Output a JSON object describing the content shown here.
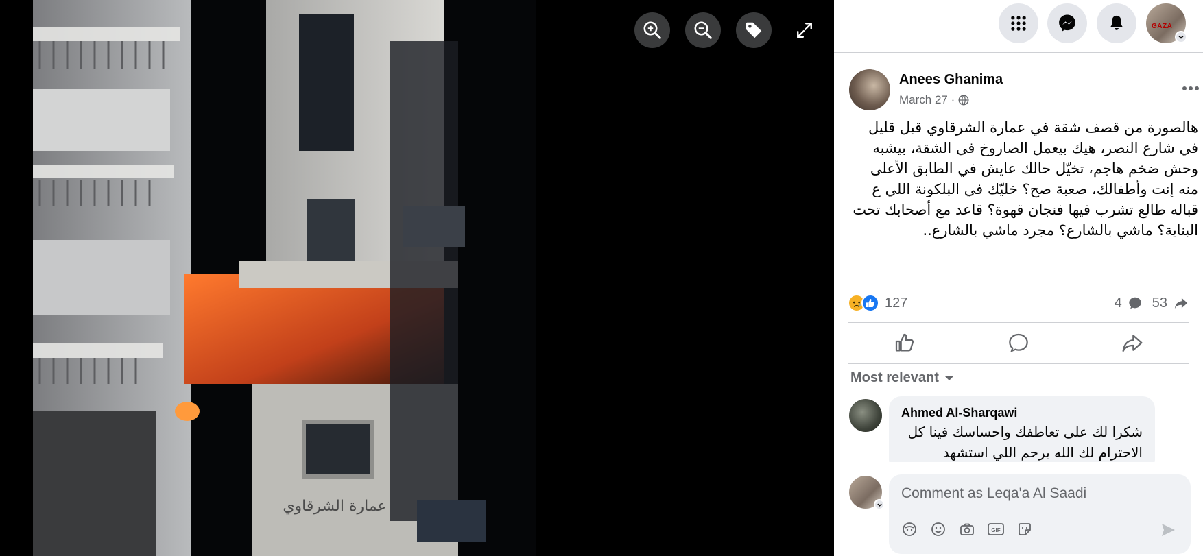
{
  "viewer": {
    "photo_alt": "Night photo of a damaged apartment building with fire on a balcony",
    "building_sign_text": "عمارة الشرقاوي",
    "tools": [
      {
        "name": "zoom-in",
        "icon": "zoom-in-icon"
      },
      {
        "name": "zoom-out",
        "icon": "zoom-out-icon"
      },
      {
        "name": "tag",
        "icon": "tag-icon"
      },
      {
        "name": "fullscreen",
        "icon": "expand-icon"
      }
    ]
  },
  "topbar": {
    "buttons": [
      {
        "name": "menu",
        "icon": "grid-menu-icon"
      },
      {
        "name": "messenger",
        "icon": "messenger-icon"
      },
      {
        "name": "notifications",
        "icon": "bell-icon"
      }
    ],
    "profile_avatar_text": "GAZA"
  },
  "post": {
    "author": "Anees Ghanima",
    "date": "March 27 ·",
    "privacy_icon": "globe-icon",
    "text": "هالصورة من قصف شقة في عمارة الشرقاوي قبل قليل في شارع النصر، هيك بيعمل الصاروخ في الشقة، بيشبه وحش ضخم هاجم، تخيّل حالك عايش في الطابق الأعلى منه إنت وأطفالك، صعبة صح؟ خليّك في البلكونة اللي ع قباله طالع تشرب فيها فنجان قهوة؟ قاعد مع أصحابك تحت البناية؟ ماشي بالشارع؟ مجرد ماشي بالشارع..",
    "reactions": {
      "count": "127",
      "comments": "4",
      "shares": "53",
      "colors": {
        "like": "#1877f2",
        "sad": "#f7b125"
      }
    }
  },
  "comments_section": {
    "sort_label": "Most relevant",
    "comments": [
      {
        "author": "Ahmed Al-Sharqawi",
        "text": "شكرا لك على تعاطفك واحساسك فينا كل الاحترام لك الله يرحم اللي استشهد"
      }
    ],
    "composer_placeholder": "Comment as Leqa'a Al Saadi"
  }
}
